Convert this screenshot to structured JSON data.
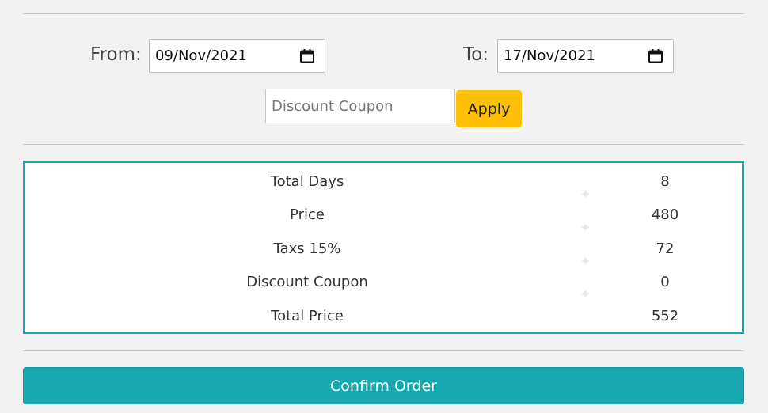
{
  "dates": {
    "from_label": "From:",
    "from_value": "09/Nov/2021",
    "to_label": "To:",
    "to_value": "17/Nov/2021"
  },
  "coupon": {
    "placeholder": "Discount Coupon",
    "value": "",
    "apply_label": "Apply"
  },
  "summary": {
    "rows": [
      {
        "label": "Total Days",
        "value": "8"
      },
      {
        "label": "Price",
        "value": "480"
      },
      {
        "label": "Taxs 15%",
        "value": "72"
      },
      {
        "label": "Discount Coupon",
        "value": "0"
      },
      {
        "label": "Total Price",
        "value": "552"
      }
    ]
  },
  "confirm_label": "Confirm Order",
  "colors": {
    "accent": "#17a8b1",
    "apply": "#ffc107",
    "background": "#f2f2f2"
  },
  "icons": [
    "calendar-icon"
  ]
}
